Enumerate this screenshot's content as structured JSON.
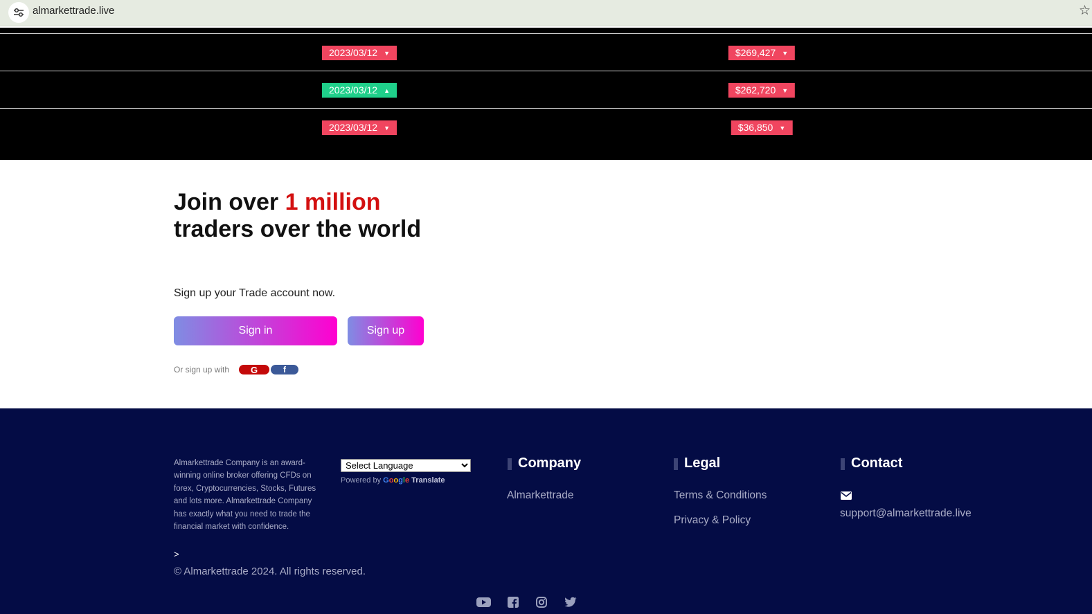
{
  "browser": {
    "url": "almarkettrade.live",
    "site_info_icon": "tune-icon",
    "bookmark_icon": "star-icon"
  },
  "ticker": {
    "rows": [
      {
        "date": "2023/03/12",
        "date_trend": "down",
        "amount": "$269,427",
        "amount_trend": "down"
      },
      {
        "date": "2023/03/12",
        "date_trend": "up",
        "amount": "$262,720",
        "amount_trend": "down"
      },
      {
        "date": "2023/03/12",
        "date_trend": "down",
        "amount": "$36,850",
        "amount_trend": "down"
      }
    ],
    "caret_down": "▼",
    "caret_up": "▲",
    "colors": {
      "down": "#f0455f",
      "up": "#1fcf8a"
    }
  },
  "cta": {
    "title_pre": "Join over ",
    "title_highlight": "1 million",
    "title_post": " traders over the world",
    "subtitle": "Sign up your Trade account now.",
    "signin_label": "Sign in",
    "signup_label": "Sign up",
    "or_signup_with": "Or sign up with",
    "google_label": "G",
    "facebook_label": "f",
    "highlight_color": "#d31010"
  },
  "footer": {
    "about": "Almarkettrade Company is an award-winning online broker offering CFDs on forex, Cryptocurrencies, Stocks, Futures and lots more. Almarkettrade Company has exactly what you need to trade the financial market with confidence.",
    "gt_symbol": ">",
    "copyright": "© Almarkettrade 2024. All rights reserved.",
    "language_select": "Select Language",
    "powered_by": "Powered by",
    "google_word": "Google",
    "translate_word": "Translate",
    "company": {
      "heading": "Company",
      "links": [
        "Almarkettrade"
      ]
    },
    "legal": {
      "heading": "Legal",
      "links": [
        "Terms & Conditions",
        "Privacy & Policy"
      ]
    },
    "contact": {
      "heading": "Contact",
      "email": "support@almarkettrade.live"
    },
    "social": [
      "youtube-icon",
      "facebook-icon",
      "instagram-icon",
      "twitter-icon"
    ],
    "background": "#040c45"
  }
}
